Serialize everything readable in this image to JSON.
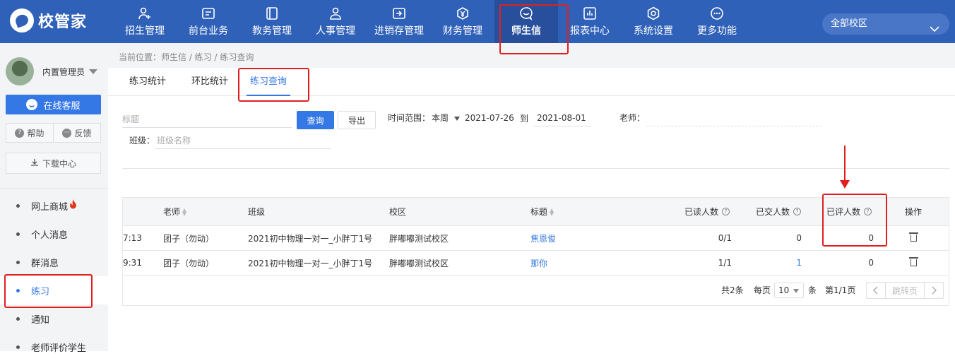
{
  "brand": {
    "name": "校管家"
  },
  "nav": [
    {
      "label": "招生管理",
      "icon": "person-add-icon"
    },
    {
      "label": "前台业务",
      "icon": "monitor-icon"
    },
    {
      "label": "教务管理",
      "icon": "book-icon"
    },
    {
      "label": "人事管理",
      "icon": "person-icon"
    },
    {
      "label": "进销存管理",
      "icon": "box-arrow-icon"
    },
    {
      "label": "财务管理",
      "icon": "yen-icon"
    },
    {
      "label": "师生信",
      "icon": "chat-icon",
      "active": true
    },
    {
      "label": "报表中心",
      "icon": "chart-icon"
    },
    {
      "label": "系统设置",
      "icon": "gear-icon"
    },
    {
      "label": "更多功能",
      "icon": "more-icon"
    }
  ],
  "campus": {
    "selected": "全部校区"
  },
  "user": {
    "name": "内置管理员"
  },
  "sidebar": {
    "service": "在线客服",
    "help": "帮助",
    "feedback": "反馈",
    "download": "下载中心",
    "menu": [
      {
        "label": "网上商城"
      },
      {
        "label": "个人消息"
      },
      {
        "label": "群消息"
      },
      {
        "label": "练习",
        "active": true
      },
      {
        "label": "通知"
      },
      {
        "label": "老师评价学生"
      }
    ]
  },
  "breadcrumb": "当前位置：师生信 / 练习 / 练习查询",
  "tabs": [
    {
      "label": "练习统计"
    },
    {
      "label": "环比统计"
    },
    {
      "label": "练习查询",
      "active": true
    }
  ],
  "filters": {
    "title_placeholder": "标题",
    "query": "查询",
    "export": "导出",
    "time_label": "时间范围：",
    "period": "本周",
    "start": "2021-07-26",
    "to": "到",
    "end": "2021-08-01",
    "teacher_label": "老师：",
    "class_label": "班级：",
    "class_placeholder": "班级名称"
  },
  "table": {
    "headers": {
      "teacher": "老师",
      "class": "班级",
      "campus": "校区",
      "title": "标题",
      "read": "已读人数",
      "submitted": "已交人数",
      "reviewed": "已评人数",
      "action": "操作"
    },
    "rows": [
      {
        "time": "7:13",
        "teacher": "团子（勿动）",
        "class": "2021初中物理一对一_小胖丁1号",
        "campus": "胖嘟嘟测试校区",
        "title": "焦恩俊",
        "read": "0/1",
        "submitted": "0",
        "reviewed": "0"
      },
      {
        "time": "9:31",
        "teacher": "团子（勿动）",
        "class": "2021初中物理一对一_小胖丁1号",
        "campus": "胖嘟嘟测试校区",
        "title": "那你",
        "read": "1/1",
        "submitted": "1",
        "reviewed": "0"
      }
    ]
  },
  "pagination": {
    "total": "共2条",
    "per_page_label": "每页",
    "per_page": "10",
    "unit": "条",
    "page": "第1/1页",
    "jump": "跳转页"
  }
}
